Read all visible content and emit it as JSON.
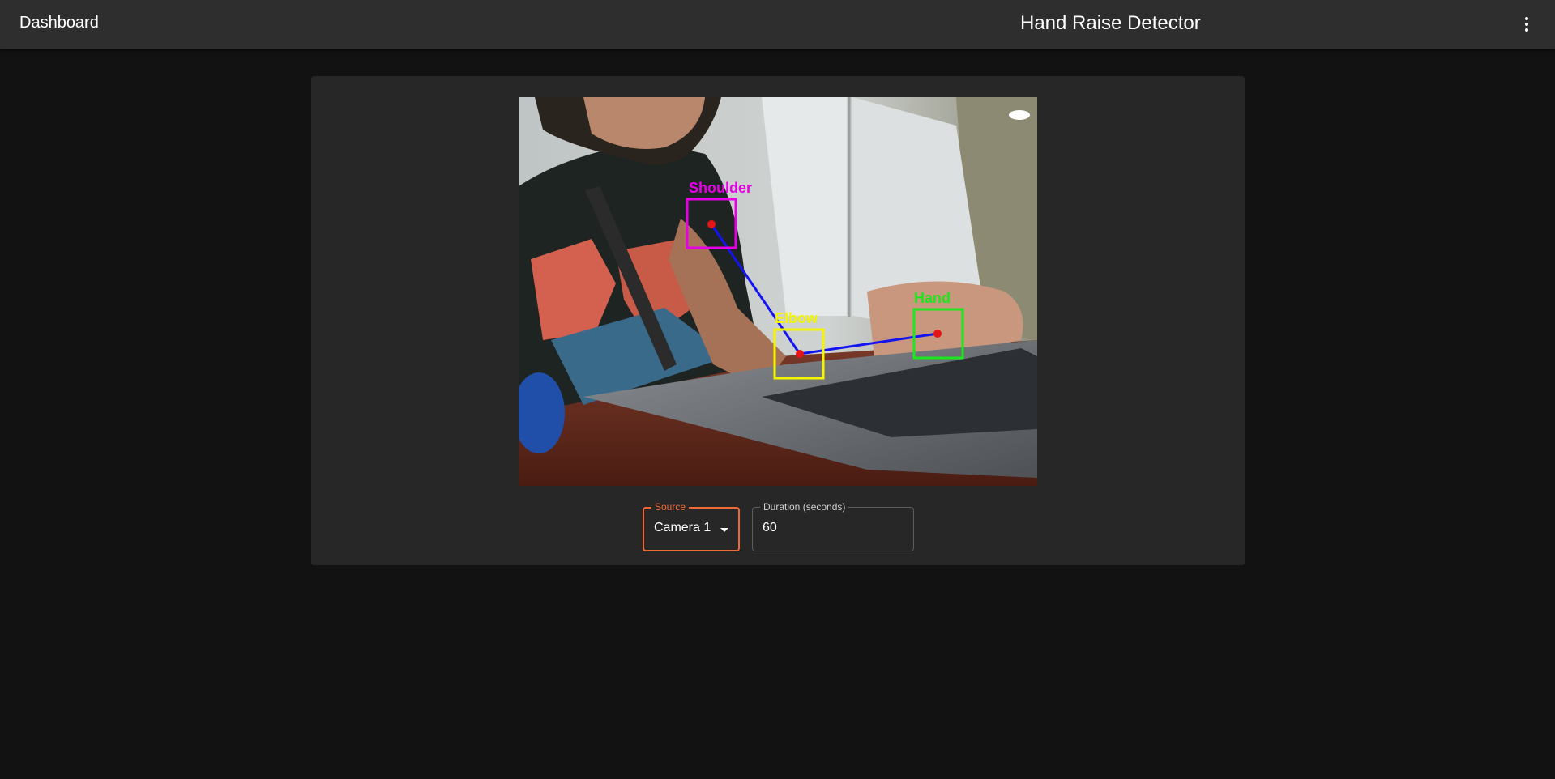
{
  "appbar": {
    "brand": "Dashboard",
    "title": "Hand Raise Detector",
    "menu_icon": "more-vertical-icon"
  },
  "feed": {
    "annotations": {
      "shoulder": "Shoulder",
      "elbow": "Elbow",
      "hand": "Hand"
    },
    "colors": {
      "shoulder": "#e600e6",
      "elbow": "#f5f500",
      "hand": "#1ee61e",
      "limb_line": "#1414f0",
      "joint": "#e61414"
    }
  },
  "controls": {
    "source": {
      "label": "Source",
      "value": "Camera 1"
    },
    "duration": {
      "label": "Duration (seconds)",
      "value": "60"
    }
  },
  "colors": {
    "accent": "#f06a35",
    "appbar_bg": "#2e2e2e",
    "page_bg": "#121212",
    "card_bg": "#272727"
  }
}
